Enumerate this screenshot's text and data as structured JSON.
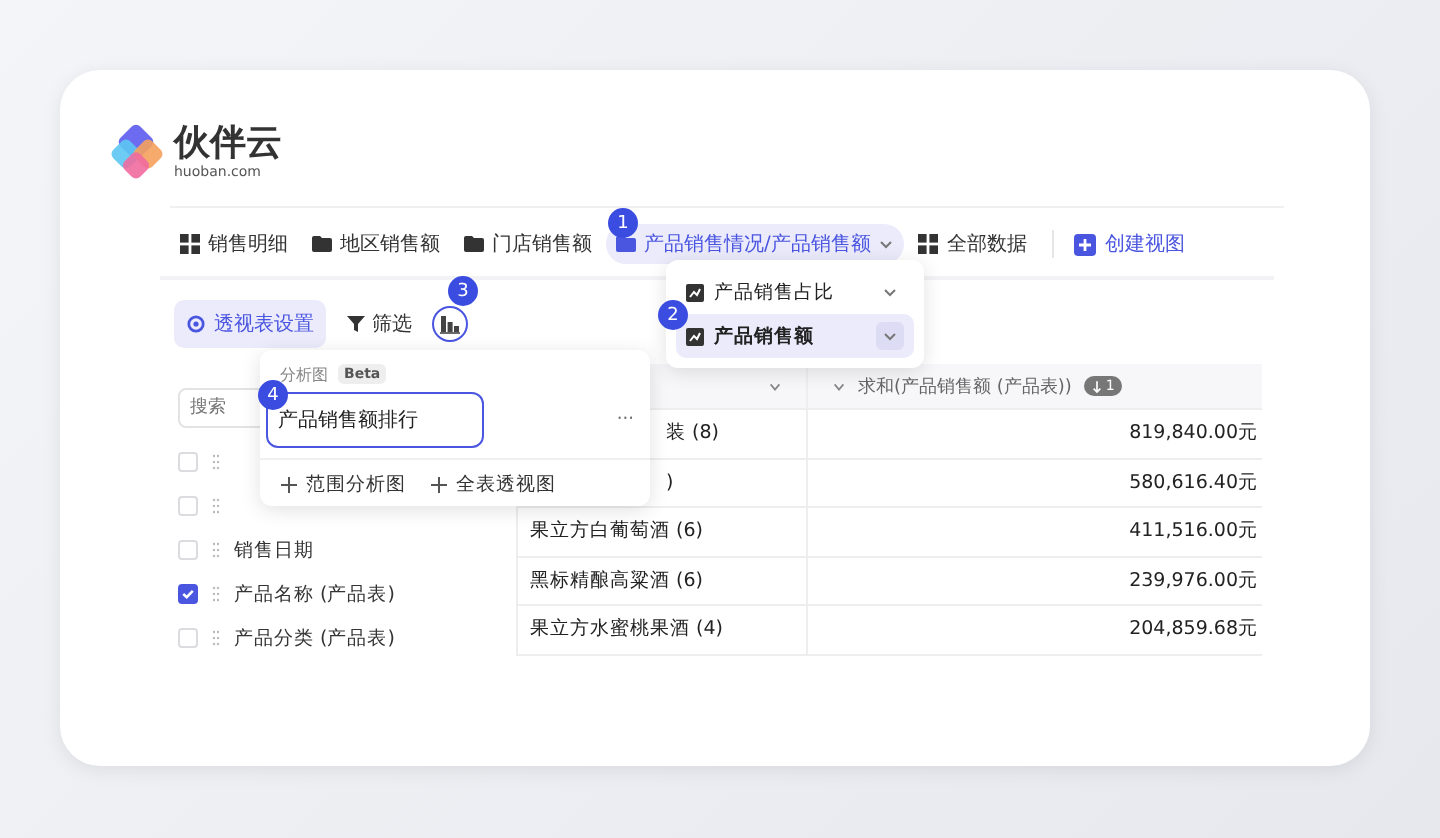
{
  "logo": {
    "name": "伙伴云",
    "domain": "huoban.com"
  },
  "nav": [
    {
      "label": "销售明细",
      "kind": "grid",
      "selected": false
    },
    {
      "label": "地区销售额",
      "kind": "folder",
      "selected": false
    },
    {
      "label": "门店销售额",
      "kind": "folder",
      "selected": false
    },
    {
      "label": "产品销售情况/产品销售额",
      "kind": "folder",
      "selected": true
    },
    {
      "label": "全部数据",
      "kind": "grid",
      "selected": false
    }
  ],
  "create_view": "创建视图",
  "toolbar": {
    "settings": "透视表设置",
    "filter": "筛选",
    "chart_outlined": true
  },
  "field_search": {
    "placeholder": "搜索"
  },
  "fields": [
    {
      "checked": false
    },
    {
      "checked": false
    },
    {
      "label": "销售日期",
      "checked": false
    },
    {
      "label": "产品名称 (产品表)",
      "checked": true
    },
    {
      "label": "产品分类 (产品表)",
      "checked": false
    }
  ],
  "table": {
    "value_header": "求和(产品销售额 (产品表))",
    "sort_badge": "1",
    "rows": [
      {
        "name": "装 (8)",
        "kind": "partial",
        "value": "819,840.00元"
      },
      {
        "name": ")",
        "kind": "partial",
        "value": "580,616.40元"
      },
      {
        "name": "果立方白葡萄酒 (6)",
        "kind": "full",
        "value": "411,516.00元"
      },
      {
        "name": "黑标精酿高粱酒 (6)",
        "kind": "full",
        "value": "239,976.00元"
      },
      {
        "name": "果立方水蜜桃果酒 (4)",
        "kind": "full",
        "value": "204,859.68元"
      }
    ]
  },
  "view_menu": [
    {
      "label": "产品销售占比",
      "selected": false
    },
    {
      "label": "产品销售额",
      "selected": true
    }
  ],
  "chart_popup": {
    "section": "分析图",
    "badge": "Beta",
    "items": [
      {
        "label": "产品销售额排行",
        "selected": true,
        "more": "···"
      }
    ],
    "actions": [
      "范围分析图",
      "全表透视图"
    ]
  },
  "callouts": [
    "1",
    "2",
    "3",
    "4"
  ]
}
